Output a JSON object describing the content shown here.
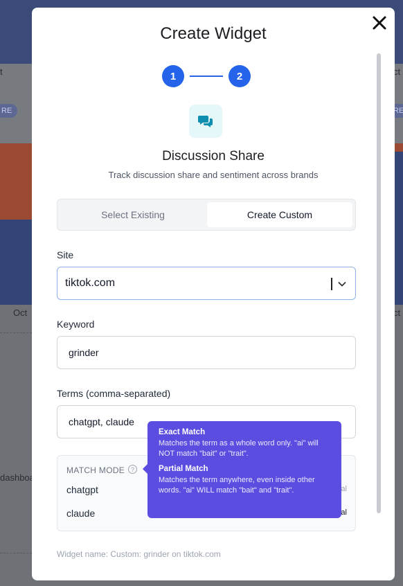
{
  "background": {
    "left_labels": [
      "t",
      "RE",
      "Oct",
      "dashboa"
    ],
    "right_labels": [
      "ct",
      "RE",
      "ct"
    ]
  },
  "modal": {
    "title": "Create Widget",
    "steps": [
      "1",
      "2"
    ],
    "icon": "chat-bubbles-icon",
    "widget_name": "Discussion Share",
    "widget_description": "Track discussion share and sentiment across brands",
    "tabs": [
      {
        "label": "Select Existing",
        "active": false
      },
      {
        "label": "Create Custom",
        "active": true
      }
    ],
    "site": {
      "label": "Site",
      "value": "tiktok.com"
    },
    "keyword": {
      "label": "Keyword",
      "value": "grinder"
    },
    "terms": {
      "label": "Terms (comma-separated)",
      "value": "chatgpt, claude"
    },
    "match_mode": {
      "title": "MATCH MODE",
      "help": "?",
      "rows": [
        {
          "term": "chatgpt",
          "mode": "Partial"
        },
        {
          "term": "claude",
          "mode": "Partial"
        }
      ]
    },
    "tooltip": {
      "exact_title": "Exact Match",
      "exact_text": "Matches the term as a whole word only. \"ai\" will NOT match \"bait\" or \"trait\".",
      "partial_title": "Partial Match",
      "partial_text": "Matches the term anywhere, even inside other words. \"ai\" WILL match \"bait\" and \"trait\"."
    },
    "footer": "Widget name: Custom: grinder on tiktok.com"
  },
  "colors": {
    "accent": "#2563eb",
    "tooltip": "#5b4de0",
    "icon_bg": "#e6f7fa",
    "icon_fg": "#0e8fb0"
  }
}
